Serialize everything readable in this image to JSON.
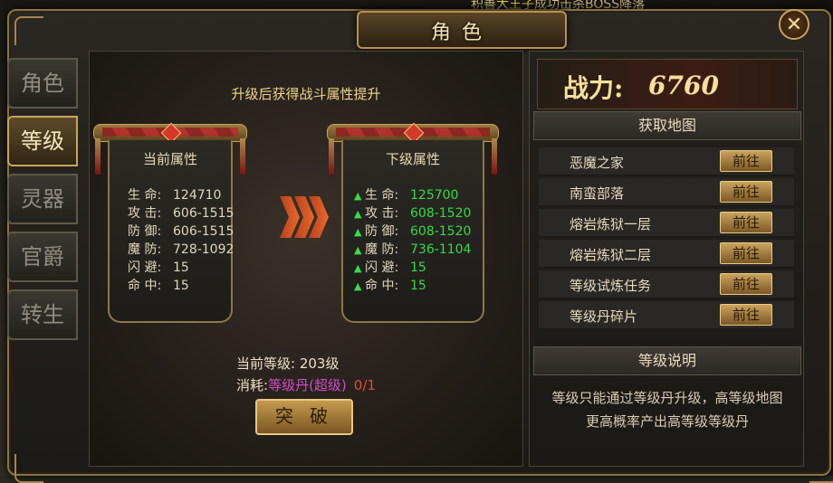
{
  "ticker": {
    "text_a": "积善",
    "text_b": "大王子",
    "text_c": "成功击杀BOSS降落"
  },
  "window": {
    "title": "角色",
    "close_icon": "close-icon"
  },
  "tabs": [
    {
      "label": "角色",
      "active": false
    },
    {
      "label": "等级",
      "active": true
    },
    {
      "label": "灵器",
      "active": false
    },
    {
      "label": "官爵",
      "active": false
    },
    {
      "label": "转生",
      "active": false
    }
  ],
  "center": {
    "heading": "升级后获得战斗属性提升",
    "current": {
      "title": "当前属性",
      "stats": [
        {
          "label": "生  命:",
          "value": "124710"
        },
        {
          "label": "攻  击:",
          "value": "606-1515"
        },
        {
          "label": "防  御:",
          "value": "606-1515"
        },
        {
          "label": "魔  防:",
          "value": "728-1092"
        },
        {
          "label": "闪  避:",
          "value": "15"
        },
        {
          "label": "命  中:",
          "value": "15"
        }
      ]
    },
    "next": {
      "title": "下级属性",
      "stats": [
        {
          "label": "生  命:",
          "value": "125700"
        },
        {
          "label": "攻  击:",
          "value": "608-1520"
        },
        {
          "label": "防  御:",
          "value": "608-1520"
        },
        {
          "label": "魔  防:",
          "value": "736-1104"
        },
        {
          "label": "闪  避:",
          "value": "15"
        },
        {
          "label": "命  中:",
          "value": "15"
        }
      ]
    },
    "level_label": "当前等级:",
    "level_value": "203级",
    "consume_label": "消耗:",
    "consume_item": "等级丹(超级)",
    "consume_count": "0/1",
    "break_button": "突 破"
  },
  "right": {
    "power_label": "战力:",
    "power_value": "6760",
    "maps_header": "获取地图",
    "maps": [
      {
        "name": "恶魔之家",
        "button": "前往"
      },
      {
        "name": "南蛮部落",
        "button": "前往"
      },
      {
        "name": "熔岩炼狱一层",
        "button": "前往"
      },
      {
        "name": "熔岩炼狱二层",
        "button": "前往"
      },
      {
        "name": "等级试炼任务",
        "button": "前往"
      },
      {
        "name": "等级丹碎片",
        "button": "前往"
      }
    ],
    "desc_header": "等级说明",
    "desc_text": "等级只能通过等级丹升级，高等级地图更高概率产出高等级等级丹"
  }
}
